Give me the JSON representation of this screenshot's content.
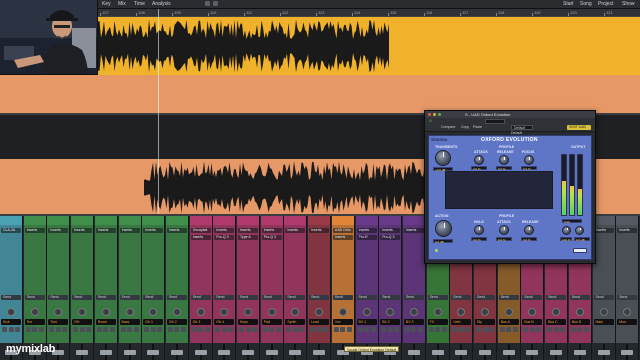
{
  "menubar": {
    "items": [
      "Key",
      "Mix",
      "Time",
      "Analysis",
      "Start",
      "Song",
      "Project",
      "Show"
    ]
  },
  "ruler": {
    "marks": [
      "107",
      "108",
      "109",
      "110",
      "111",
      "112",
      "113",
      "114",
      "115",
      "116",
      "117",
      "118",
      "119",
      "120",
      "121"
    ]
  },
  "colors": {
    "track_yellow": "#f0b22a",
    "track_salmon": "#e69866",
    "waveform_dark": "#1a1a1a",
    "plugin_face": "#5f76c6"
  },
  "plugin": {
    "window_title": "S - UAD Oxford Evolution",
    "preset_label": "Default",
    "tools": {
      "compare": "Compare",
      "copy": "Copy",
      "paste": "Paste",
      "default": "Default",
      "uad_badge": "VISIT UAD"
    },
    "brand": "Sonnox",
    "title": "OXFORD EVOLUTION",
    "sections": {
      "transients": "TRANSIENTS",
      "profile_top": "PROFILE",
      "action": "ACTION",
      "profile_bottom": "PROFILE",
      "output": "OUTPUT"
    },
    "top_knobs": [
      {
        "label": "GAIN",
        "value": "+0.0 dB"
      },
      {
        "label": "ATTACK",
        "value": "0.0 %"
      },
      {
        "label": "RELEASE",
        "value": "0.0 %"
      },
      {
        "label": "FOCUS",
        "value": "0.0 %"
      }
    ],
    "bottom_knobs": [
      {
        "label": "GAIN",
        "value": "0.0 dB"
      },
      {
        "label": "HOLD",
        "value": "0.0 %"
      },
      {
        "label": "ATTACK",
        "value": "0.0 %"
      },
      {
        "label": "RELEASE",
        "value": "0.0 %"
      }
    ],
    "output": {
      "trim_value": "0.00",
      "mix_value": "100 %",
      "out_value": "0.0 dB"
    }
  },
  "mixer": {
    "strips": [
      {
        "color": "#4aa1b3",
        "inserts": [
          "CLA-2A"
        ],
        "send": "Send",
        "name": "Kick"
      },
      {
        "color": "#3f8e4a",
        "inserts": [
          "Inserts"
        ],
        "send": "Send",
        "name": "Snr"
      },
      {
        "color": "#3f8e4a",
        "inserts": [
          "Inserts"
        ],
        "send": "Send",
        "name": "Tom"
      },
      {
        "color": "#3f8e4a",
        "inserts": [
          "Inserts"
        ],
        "send": "Send",
        "name": "OH"
      },
      {
        "color": "#3f8e4a",
        "inserts": [
          "Inserts"
        ],
        "send": "Send",
        "name": "Room"
      },
      {
        "color": "#3f8e4a",
        "inserts": [
          "Inserts"
        ],
        "send": "Send",
        "name": "Bass"
      },
      {
        "color": "#3f8e4a",
        "inserts": [
          "Inserts"
        ],
        "send": "Send",
        "name": "Gtr 1"
      },
      {
        "color": "#3f8e4a",
        "inserts": [
          "Inserts"
        ],
        "send": "Send",
        "name": "Gtr 2"
      },
      {
        "color": "#b03a6b",
        "inserts": [
          "Decapitat",
          "Inserts"
        ],
        "send": "Send",
        "name": "Gtr 3"
      },
      {
        "color": "#b03a6b",
        "inserts": [
          "Inserts",
          "Pro-Q 3"
        ],
        "send": "Send",
        "name": "Gtr 4"
      },
      {
        "color": "#b03a6b",
        "inserts": [
          "Inserts",
          "Type A"
        ],
        "send": "Send",
        "name": "Keys"
      },
      {
        "color": "#b03a6b",
        "inserts": [
          "Inserts",
          "Pro-Q 3"
        ],
        "send": "Send",
        "name": "Pad"
      },
      {
        "color": "#b03a6b",
        "inserts": [
          "Inserts"
        ],
        "send": "Send",
        "name": "Synth"
      },
      {
        "color": "#9a3a48",
        "inserts": [
          "Inserts"
        ],
        "send": "Send",
        "name": "Lead"
      },
      {
        "color": "#e0853a",
        "inserts": [
          "UAD Oxfo",
          "Inserts"
        ],
        "send": "Send",
        "name": "Vox"
      },
      {
        "color": "#6a3a8a",
        "inserts": [
          "Inserts",
          "Pro-R"
        ],
        "send": "Send",
        "name": "BV 1"
      },
      {
        "color": "#6a3a8a",
        "inserts": [
          "Inserts",
          "Pro-Q 3"
        ],
        "send": "Send",
        "name": "BV 2"
      },
      {
        "color": "#6a3a8a",
        "inserts": [
          "Inserts"
        ],
        "send": "Send",
        "name": "BV 3"
      },
      {
        "color": "#3c8a3c",
        "inserts": [
          "Inserts"
        ],
        "send": "Send",
        "name": "FX"
      },
      {
        "color": "#9a3a48",
        "inserts": [
          "Inserts"
        ],
        "send": "Send",
        "name": "Verb"
      },
      {
        "color": "#9a3a48",
        "inserts": [
          "Inserts"
        ],
        "send": "Send",
        "name": "Dly"
      },
      {
        "color": "#a06a2a",
        "inserts": [
          "Inserts"
        ],
        "send": "Send",
        "name": "Bus A"
      },
      {
        "color": "#b03a6b",
        "inserts": [
          "Inserts"
        ],
        "send": "Send",
        "name": "Bus B"
      },
      {
        "color": "#b03a6b",
        "inserts": [
          "Inserts"
        ],
        "send": "Send",
        "name": "Bus C"
      },
      {
        "color": "#b03a6b",
        "inserts": [
          "Inserts"
        ],
        "send": "Send",
        "name": "Bus D"
      },
      {
        "color": "#555a62",
        "inserts": [
          "Inserts"
        ],
        "send": "Send",
        "name": "Main"
      },
      {
        "color": "#555a62",
        "inserts": [
          "Inserts"
        ],
        "send": "Send",
        "name": "Mon"
      }
    ]
  },
  "tooltip": "Vocals Oxford Evolution Default",
  "watermark": "mymixlab"
}
